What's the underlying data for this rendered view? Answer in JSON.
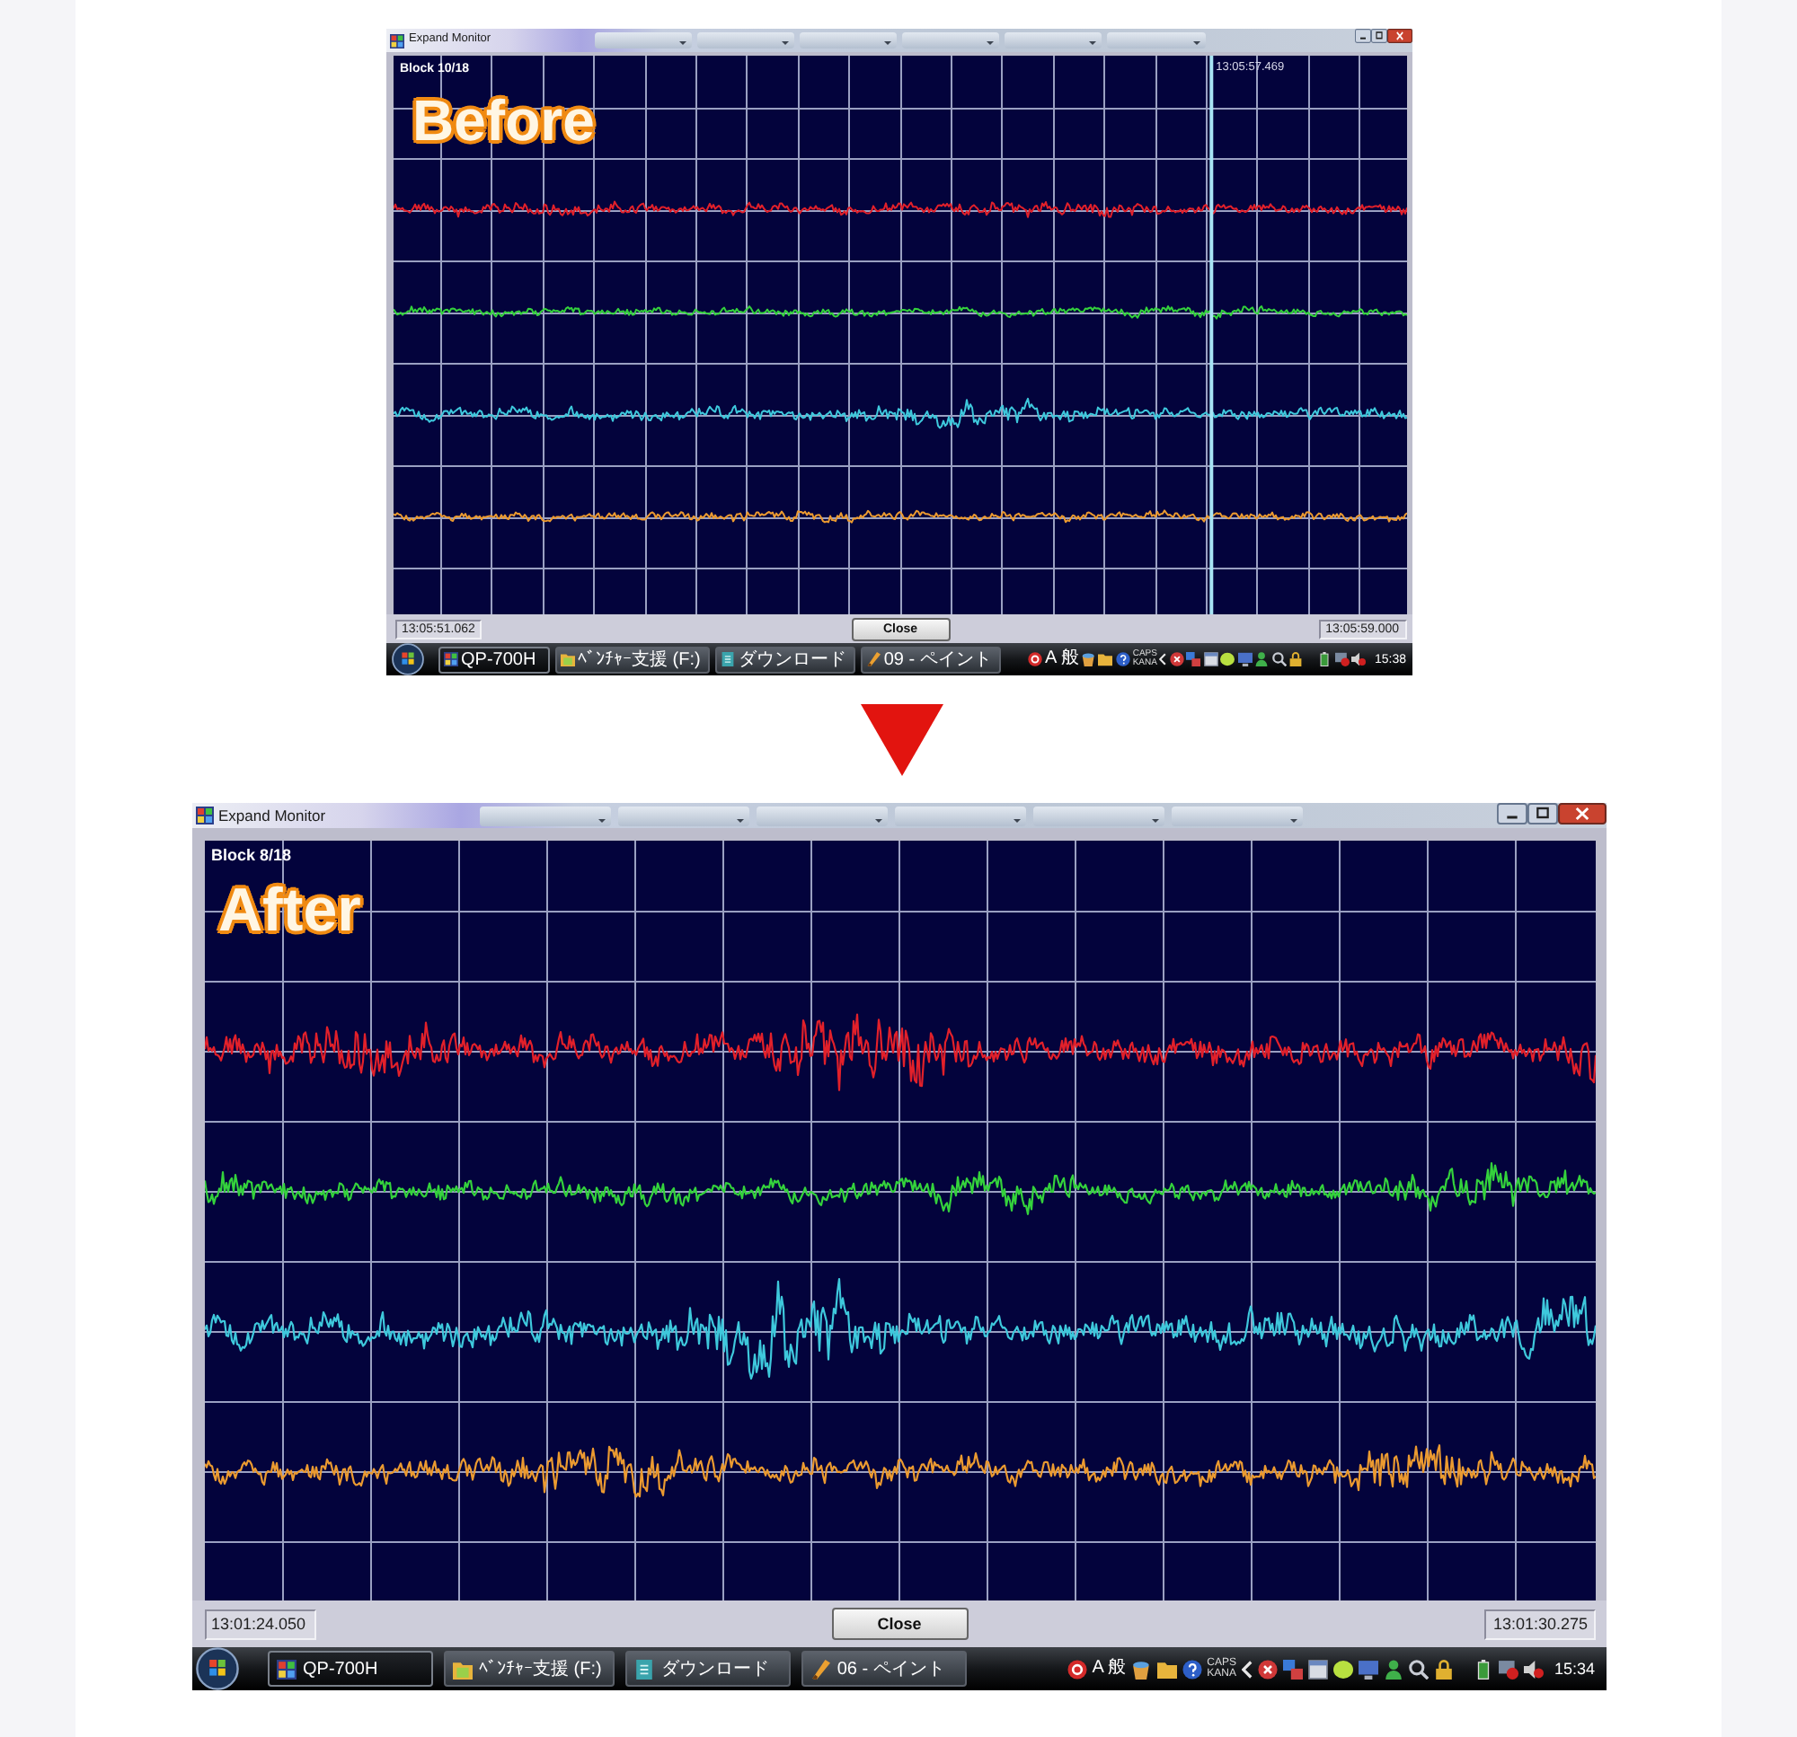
{
  "screenshots": [
    {
      "kind": "small",
      "label": "Before",
      "window": {
        "title": "Expand Monitor"
      },
      "plot": {
        "block": "Block 10/18",
        "cursor": {
          "time": "13:05:57.469",
          "level": 0.807
        },
        "traces": [
          {
            "color": "#e2202a"
          },
          {
            "color": "#34d23c"
          },
          {
            "color": "#3ec8dc"
          },
          {
            "color": "#eb9a30"
          }
        ]
      },
      "status": {
        "start_time": "13:05:51.062",
        "button": "Close",
        "end_time": "13:05:59.000"
      },
      "taskbar": {
        "tasks": [
          {
            "label": "QP-700H",
            "selected": true
          },
          {
            "label": "ﾍﾞﾝﾁｬｰ支援 (F:)",
            "selected": false
          },
          {
            "label": "ダウンロード",
            "selected": false
          },
          {
            "label": "09 - ペイント",
            "selected": false
          }
        ],
        "ime": "A 般",
        "caps": "CAPS",
        "kana": "KANA",
        "clock": "15:38"
      }
    },
    {
      "kind": "large",
      "label": "After",
      "window": {
        "title": "Expand Monitor"
      },
      "plot": {
        "block": "Block 8/18",
        "traces": [
          {
            "color": "#e2202a"
          },
          {
            "color": "#34d23c"
          },
          {
            "color": "#3ec8dc"
          },
          {
            "color": "#eb9a30"
          }
        ]
      },
      "status": {
        "start_time": "13:01:24.050",
        "button": "Close",
        "end_time": "13:01:30.275"
      },
      "taskbar": {
        "tasks": [
          {
            "label": "QP-700H",
            "selected": true
          },
          {
            "label": "ﾍﾞﾝﾁｬｰ支援 (F:)",
            "selected": false
          },
          {
            "label": "ダウンロード",
            "selected": false
          },
          {
            "label": "06 - ペイント",
            "selected": false
          }
        ],
        "ime": "A 般",
        "caps": "CAPS",
        "kana": "KANA",
        "clock": "15:34"
      }
    }
  ]
}
